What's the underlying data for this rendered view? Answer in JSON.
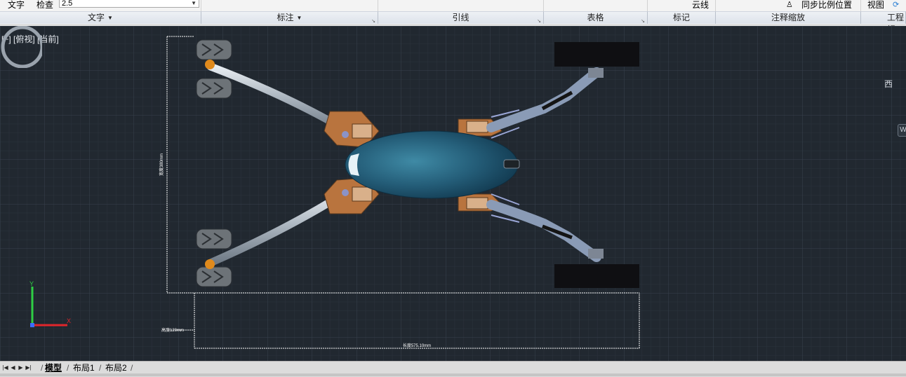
{
  "ribbon": {
    "row_labels": {
      "text": "文字",
      "check": "检查",
      "revcloud": "云线",
      "sync_scale": "同步比例位置",
      "view": "视图"
    },
    "text_height_value": "2.5",
    "panels": [
      {
        "label": "文字",
        "has_dropdown": true,
        "has_launcher": false
      },
      {
        "label": "标注",
        "has_dropdown": true,
        "has_launcher": true
      },
      {
        "label": "引线",
        "has_dropdown": false,
        "has_launcher": true
      },
      {
        "label": "表格",
        "has_dropdown": false,
        "has_launcher": true
      },
      {
        "label": "标记",
        "has_dropdown": false,
        "has_launcher": false
      },
      {
        "label": "注释缩放",
        "has_dropdown": false,
        "has_launcher": false
      },
      {
        "label": "工程视",
        "has_dropdown": false,
        "has_launcher": false
      }
    ]
  },
  "viewport": {
    "view_label": "[−] [俯视] [当前]",
    "background_color": "#212830",
    "compass_direction": "西",
    "view_cube_button": "W",
    "dimensions": {
      "width": "宽度380mm",
      "height": "高度120mm",
      "length": "长度575.10mm"
    },
    "ucs": {
      "x_axis": "X",
      "y_axis": "Y",
      "x_color": "#e0262b",
      "y_color": "#2fcf45"
    }
  },
  "layout_tabs": {
    "nav_icons": [
      "first-icon",
      "prev-icon",
      "next-icon",
      "last-icon"
    ],
    "tabs": [
      {
        "label": "模型",
        "active": true
      },
      {
        "label": "布局1",
        "active": false
      },
      {
        "label": "布局2",
        "active": false
      }
    ]
  }
}
